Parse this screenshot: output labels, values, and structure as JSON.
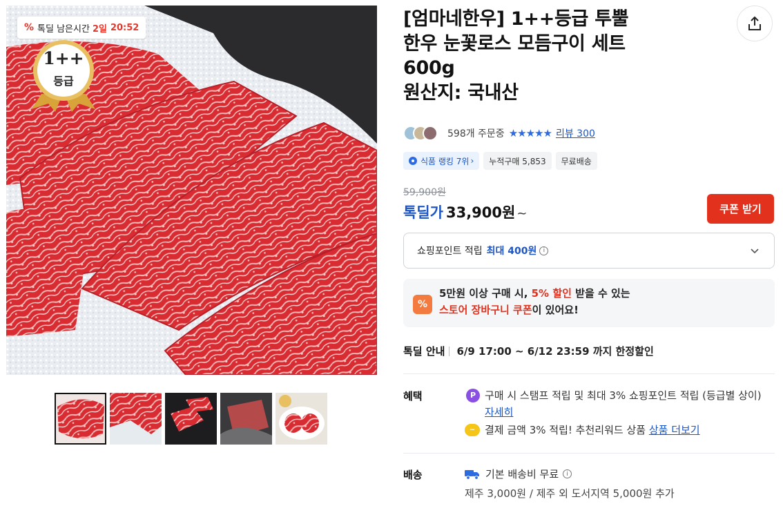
{
  "gallery": {
    "timer_icon": "%",
    "timer_label": "톡딜 남은시간",
    "timer_days": "2일",
    "timer_clock": "20:52",
    "grade_line1": "1++",
    "grade_line2": "등급"
  },
  "product": {
    "title_line1": "[엄마네한우] 1++등급 투뿔",
    "title_line2": "한우 눈꽃로스 모듬구이 세트",
    "title_line3": "600g",
    "title_line4": "원산지: 국내산"
  },
  "meta": {
    "orders": "598개 주문중",
    "stars": "★★★★★",
    "review": "리뷰 300"
  },
  "chips": {
    "rank": "식품 랭킹 7위",
    "cumulative": "누적구매 5,853",
    "free_ship": "무료배송"
  },
  "price": {
    "original": "59,900원",
    "sale_label": "톡딜가",
    "sale": "33,900원",
    "tilde": "~",
    "coupon_button": "쿠폰 받기"
  },
  "points": {
    "label": "쇼핑포인트 적립",
    "max": "최대 400원"
  },
  "promo": {
    "a": "5만원 이상 구매 시, ",
    "b": "5% 할인",
    "c": " 받을 수 있는",
    "d": "스토어 장바구니 쿠폰",
    "e": "이 있어요!"
  },
  "deal": {
    "label": "톡딜 안내",
    "period": "6/9 17:00 ~ 6/12 23:59 까지 한정할인"
  },
  "benefits": {
    "label": "혜택",
    "line1a": "구매 시 스탬프 적립 및 최대 3% 쇼핑포인트 적립 (등급별 상이) ",
    "line1_link": "자세히",
    "line2a": "결제 금액 3% 적립! 추천리워드 상품 ",
    "line2_link": "상품 더보기"
  },
  "shipping": {
    "label": "배송",
    "basic": "기본 배송비 무료",
    "extra": "제주 3,000원 / 제주 외 도서지역 5,000원 추가"
  },
  "colors": {
    "accent_blue": "#1c55c4",
    "coupon_red": "#e2321e"
  }
}
